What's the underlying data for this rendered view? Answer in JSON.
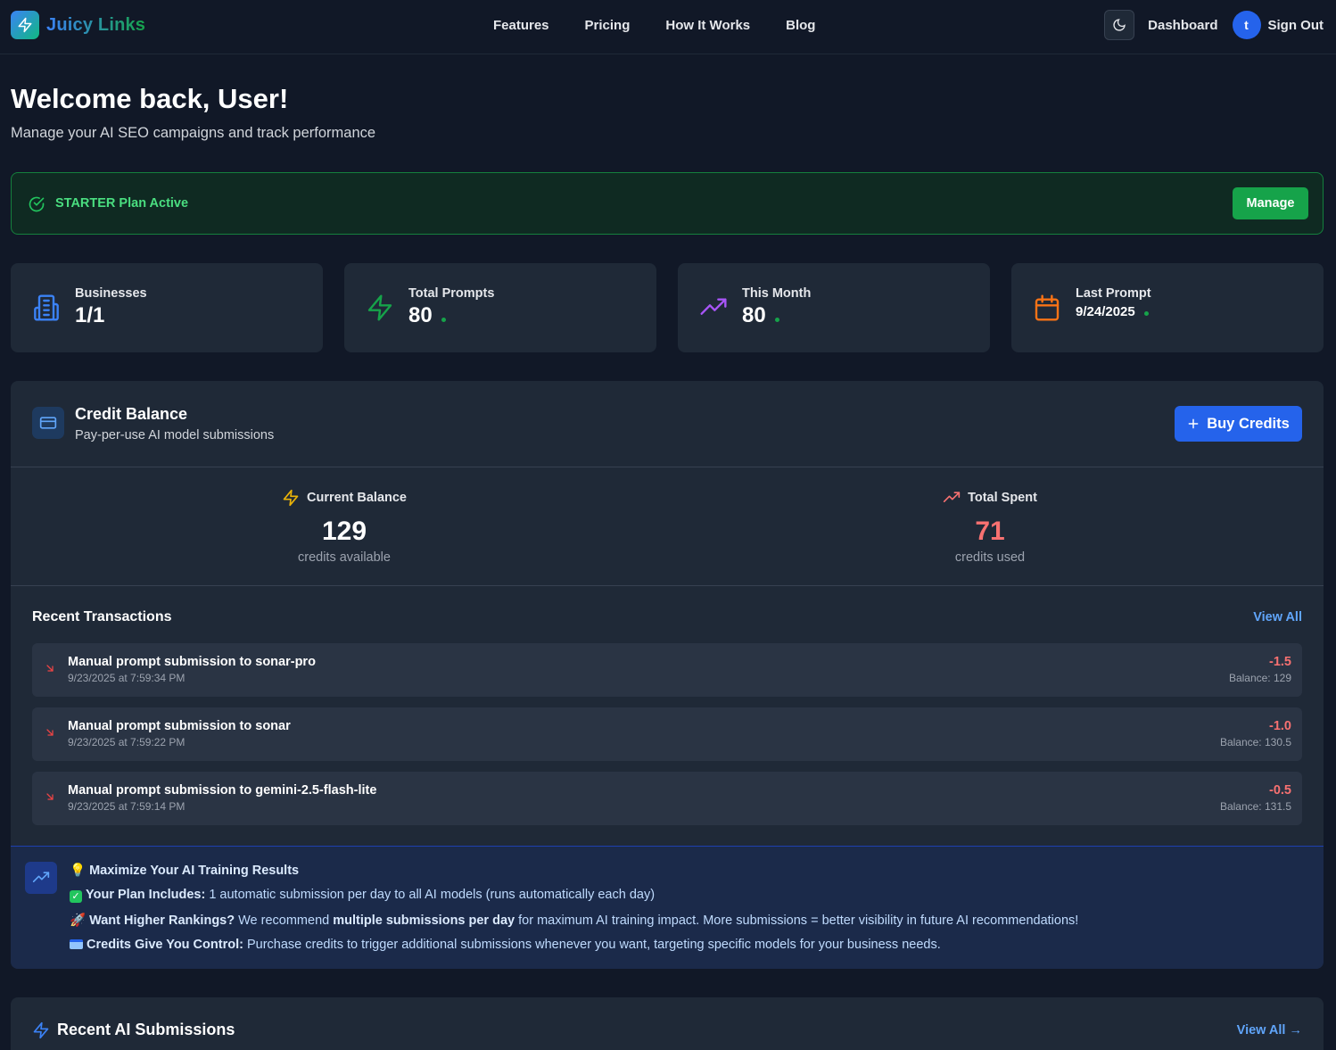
{
  "header": {
    "brand": "Juicy Links",
    "nav": [
      "Features",
      "Pricing",
      "How It Works",
      "Blog"
    ],
    "dashboard": "Dashboard",
    "avatar_initial": "t",
    "sign_out": "Sign Out"
  },
  "welcome": {
    "title": "Welcome back, User!",
    "subtitle": "Manage your AI SEO campaigns and track performance"
  },
  "plan": {
    "status": "STARTER Plan Active",
    "manage": "Manage"
  },
  "stats": [
    {
      "label": "Businesses",
      "value": "1/1",
      "icon": "building-icon"
    },
    {
      "label": "Total Prompts",
      "value": "80",
      "icon": "zap-icon"
    },
    {
      "label": "This Month",
      "value": "80",
      "icon": "trending-up-icon"
    },
    {
      "label": "Last Prompt",
      "value": "9/24/2025",
      "icon": "calendar-icon"
    }
  ],
  "credit": {
    "title": "Credit Balance",
    "subtitle": "Pay-per-use AI model submissions",
    "buy": "Buy Credits",
    "current_label": "Current Balance",
    "current_value": "129",
    "current_caption": "credits available",
    "spent_label": "Total Spent",
    "spent_value": "71",
    "spent_caption": "credits used"
  },
  "transactions": {
    "title": "Recent Transactions",
    "view_all": "View All",
    "items": [
      {
        "desc": "Manual prompt submission to sonar-pro",
        "date": "9/23/2025 at 7:59:34 PM",
        "amount": "-1.5",
        "balance": "Balance: 129"
      },
      {
        "desc": "Manual prompt submission to sonar",
        "date": "9/23/2025 at 7:59:22 PM",
        "amount": "-1.0",
        "balance": "Balance: 130.5"
      },
      {
        "desc": "Manual prompt submission to gemini-2.5-flash-lite",
        "date": "9/23/2025 at 7:59:14 PM",
        "amount": "-0.5",
        "balance": "Balance: 131.5"
      }
    ]
  },
  "tips": {
    "heading": "Maximize Your AI Training Results",
    "plan_label": "Your Plan Includes:",
    "plan_text": " 1 automatic submission per day to all AI models (runs automatically each day)",
    "rank_label": "Want Higher Rankings?",
    "rank_text_1": " We recommend ",
    "rank_bold": "multiple submissions per day",
    "rank_text_2": " for maximum AI training impact. More submissions = better visibility in future AI recommendations!",
    "credits_label": "Credits Give You Control:",
    "credits_text": " Purchase credits to trigger additional submissions whenever you want, targeting specific models for your business needs."
  },
  "submissions": {
    "title": "Recent AI Submissions",
    "view_all": "View All →"
  },
  "colors": {
    "background": "#111827",
    "card": "#1f2937",
    "accent_blue": "#2563eb",
    "success_green": "#16a34a",
    "negative_red": "#f87171"
  }
}
